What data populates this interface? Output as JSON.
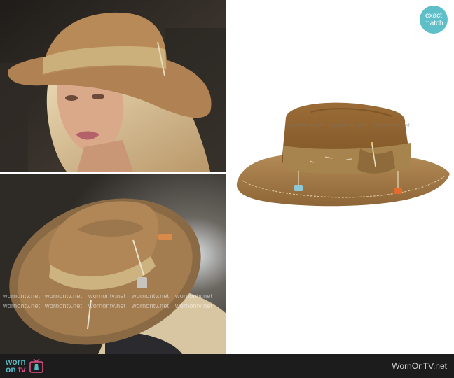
{
  "badge": {
    "line1": "exact",
    "line2": "match"
  },
  "watermark": "wornontv.net",
  "footer": {
    "logo_top": "worn",
    "logo_bottom_on": "on ",
    "logo_bottom_tv": "tv",
    "site": "WornOnTV.net"
  }
}
